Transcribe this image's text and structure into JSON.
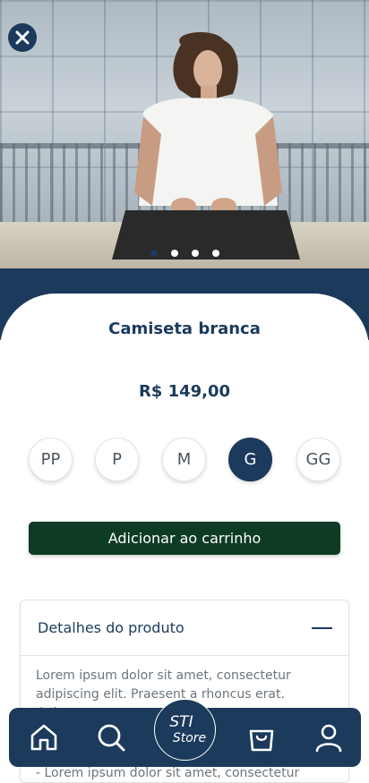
{
  "product": {
    "title": "Camiseta branca",
    "price": "R$ 149,00",
    "image_alt": "product-photo-man-white-shirt",
    "carousel": {
      "count": 4,
      "active_index": 0
    }
  },
  "sizes": [
    {
      "label": "PP",
      "selected": false
    },
    {
      "label": "P",
      "selected": false
    },
    {
      "label": "M",
      "selected": false
    },
    {
      "label": "G",
      "selected": true
    },
    {
      "label": "GG",
      "selected": false
    }
  ],
  "actions": {
    "add_to_cart": "Adicionar ao carrinho"
  },
  "details": {
    "title": "Detalhes do produto",
    "body": "Lorem ipsum dolor sit amet, consectetur adipiscing elit. Praesent a rhoncus erat. Quisque",
    "body_2": "- Lorem ipsum dolor sit amet, consectetur"
  },
  "bottom_nav": {
    "items": [
      "home-icon",
      "search-icon",
      "store-logo",
      "shopping-bag-icon",
      "user-icon"
    ],
    "logo_line1": "STI",
    "logo_line2": "Store"
  },
  "colors": {
    "primary": "#1b3a5c",
    "button": "#0e3b24",
    "text_muted": "#6c757d"
  }
}
